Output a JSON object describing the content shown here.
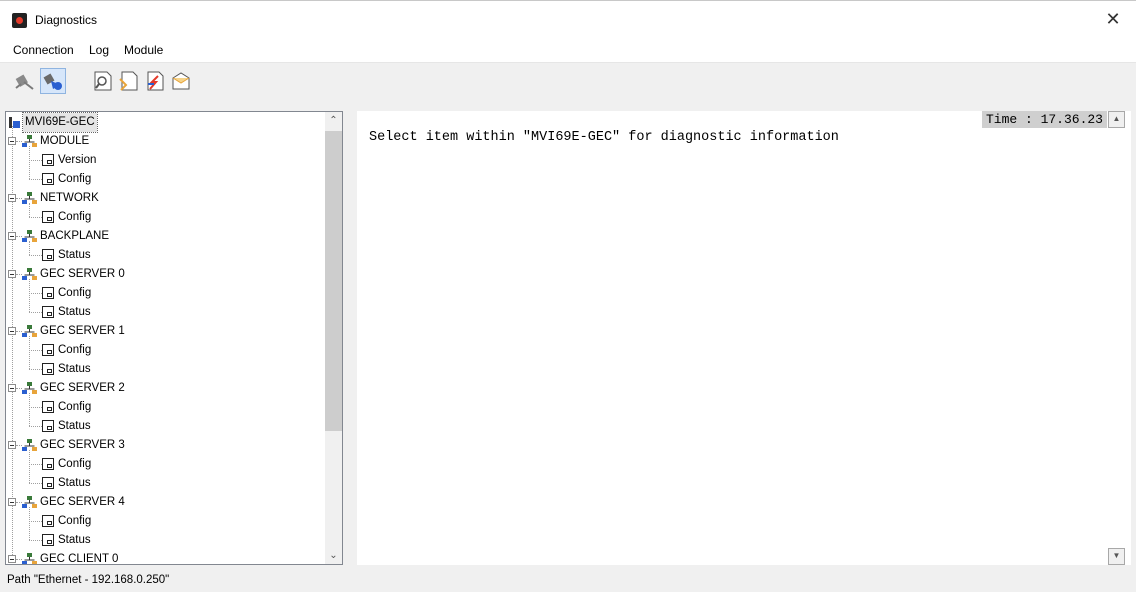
{
  "window": {
    "title": "Diagnostics",
    "close_glyph": "✕"
  },
  "menu": {
    "items": [
      "Connection",
      "Log",
      "Module"
    ]
  },
  "toolbar": {
    "buttons": [
      {
        "name": "disconnect-icon"
      },
      {
        "name": "connect-icon"
      },
      {
        "name": "find-icon"
      },
      {
        "name": "log-capture-icon"
      },
      {
        "name": "log-edit-icon"
      },
      {
        "name": "log-open-icon"
      }
    ]
  },
  "tree": {
    "root": "MVI69E-GEC",
    "groups": [
      {
        "label": "MODULE",
        "children": [
          "Version",
          "Config"
        ]
      },
      {
        "label": "NETWORK",
        "children": [
          "Config"
        ]
      },
      {
        "label": "BACKPLANE",
        "children": [
          "Status"
        ]
      },
      {
        "label": "GEC SERVER 0",
        "children": [
          "Config",
          "Status"
        ]
      },
      {
        "label": "GEC SERVER 1",
        "children": [
          "Config",
          "Status"
        ]
      },
      {
        "label": "GEC SERVER 2",
        "children": [
          "Config",
          "Status"
        ]
      },
      {
        "label": "GEC SERVER 3",
        "children": [
          "Config",
          "Status"
        ]
      },
      {
        "label": "GEC SERVER 4",
        "children": [
          "Config",
          "Status"
        ]
      },
      {
        "label": "GEC CLIENT 0",
        "children": []
      }
    ]
  },
  "content": {
    "time": "Time : 17.36.23",
    "message": "Select item within \"MVI69E-GEC\" for diagnostic information"
  },
  "status": {
    "path": "Path \"Ethernet - 192.168.0.250\""
  },
  "colors": {
    "accent_red": "#e43a2a",
    "tool_blue": "#2a5fd0",
    "tool_orange": "#e8a43a"
  }
}
